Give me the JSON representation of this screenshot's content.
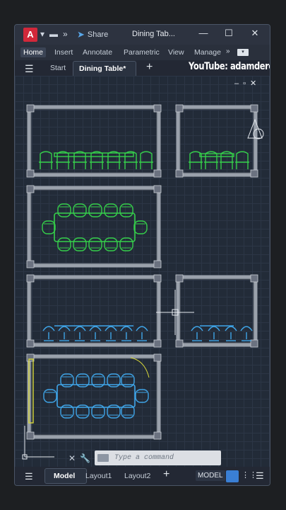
{
  "app": {
    "logo_letter": "A",
    "share_label": "Share",
    "title": "Dining Tab..."
  },
  "ribbon": {
    "tabs": [
      "Home",
      "Insert",
      "Annotate",
      "Parametric",
      "View",
      "Manage"
    ],
    "active_tab": "Home"
  },
  "doc_tabs": {
    "start_label": "Start",
    "active_label": "Dining Table*",
    "add_label": "+"
  },
  "overlay": {
    "watermark_text": "YouTube: adamdereli"
  },
  "command_line": {
    "placeholder": "Type a command"
  },
  "status_bar": {
    "model_tab": "Model",
    "layout1_tab": "Layout1",
    "layout2_tab": "Layout2",
    "model_badge": "MODEL"
  },
  "colors": {
    "accent_green": "#35d04a",
    "accent_blue": "#3fa5e8",
    "wall": "#9aa1ab",
    "logo_red": "#d2283a",
    "grid_active": "#3a7fd4"
  },
  "icons": [
    "app-logo",
    "folder-icon",
    "share-icon",
    "hamburger-icon",
    "plus-icon",
    "minimize-icon",
    "maximize-icon",
    "close-icon",
    "wrench-icon",
    "grid-icon",
    "snap-icon",
    "customize-icon"
  ]
}
